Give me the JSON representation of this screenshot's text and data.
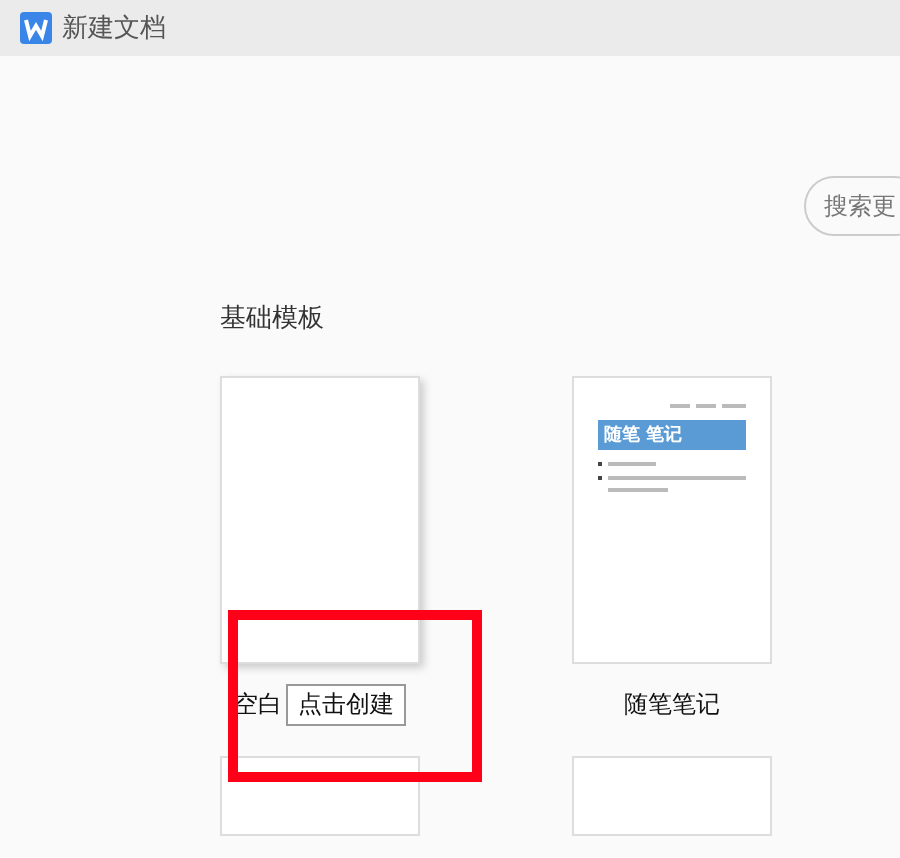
{
  "window": {
    "title": "新建文档"
  },
  "search": {
    "placeholder": "搜索更"
  },
  "section": {
    "title": "基础模板"
  },
  "templates": [
    {
      "kind": "blank",
      "label": "空白",
      "tooltip": "点击创建"
    },
    {
      "kind": "note",
      "label": "随笔笔记",
      "heading": "随笔 笔记"
    },
    {
      "kind": "partial"
    },
    {
      "kind": "partial"
    }
  ],
  "annotation": {
    "kind": "highlight-box"
  }
}
